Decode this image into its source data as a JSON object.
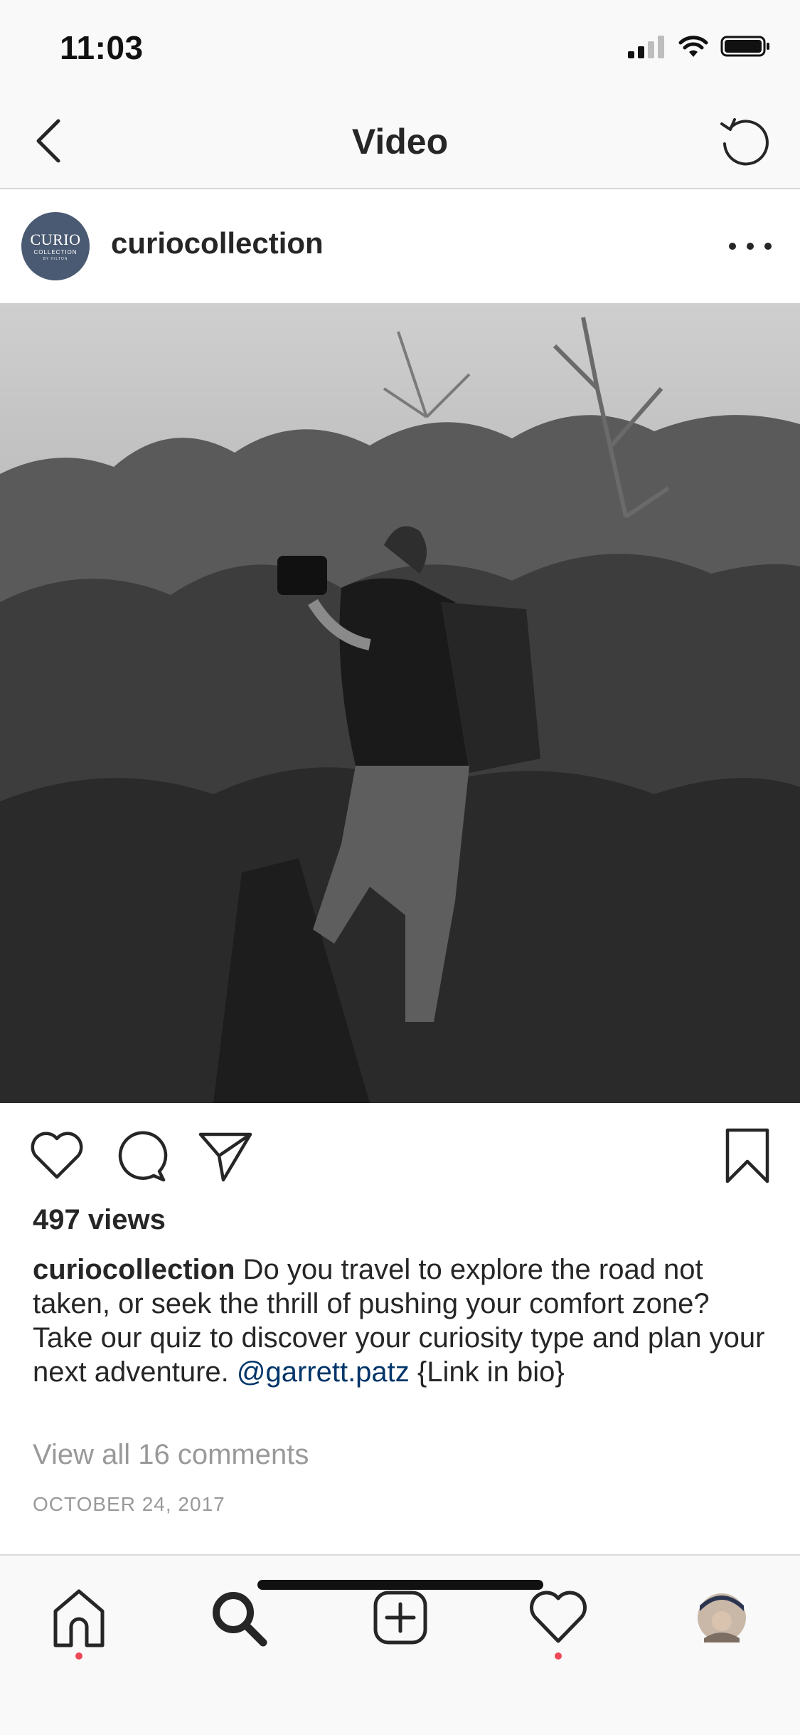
{
  "status_bar": {
    "time": "11:03"
  },
  "nav": {
    "title": "Video"
  },
  "post": {
    "avatar": {
      "main": "CURIO",
      "sub": "COLLECTION",
      "tiny": "BY HILTON"
    },
    "username": "curiocollection",
    "views": "497 views",
    "caption": {
      "user": "curiocollection",
      "text": " Do you travel to explore the road not taken, or seek the thrill of pushing your comfort zone? Take our quiz to discover your curiosity type and plan your next adventure. ",
      "mention": "@garrett.patz",
      "suffix": " {Link in bio}"
    },
    "view_comments": "View all 16 comments",
    "date": "OCTOBER 24, 2017"
  },
  "icons": {
    "back": "chevron-left-icon",
    "refresh": "refresh-icon",
    "more": "more-horizontal-icon",
    "like": "heart-icon",
    "comment": "comment-icon",
    "share": "share-icon",
    "save": "bookmark-icon"
  },
  "tab_bar": {
    "items": [
      "home",
      "search",
      "create",
      "activity",
      "profile"
    ]
  },
  "colors": {
    "accent_link": "#003569",
    "notification_dot": "#ed4956",
    "avatar_bg": "#4a5a72"
  }
}
